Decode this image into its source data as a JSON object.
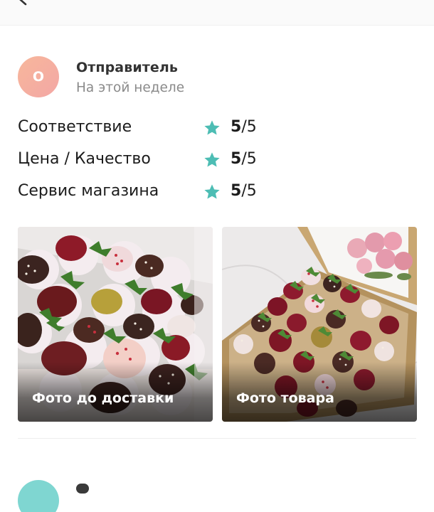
{
  "review": {
    "author": {
      "initial": "О",
      "name": "Отправитель",
      "date": "На этой неделе",
      "avatar_color": "#f5ae9e"
    },
    "ratings": [
      {
        "label": "Соответствие",
        "score": "5",
        "max": "/5"
      },
      {
        "label": "Цена / Качество",
        "score": "5",
        "max": "/5"
      },
      {
        "label": "Сервис магазина",
        "score": "5",
        "max": "/5"
      }
    ],
    "star_color": "#4dbdb4",
    "photos": [
      {
        "label": "Фото до доставки"
      },
      {
        "label": "Фото товара"
      }
    ]
  },
  "icons": {
    "back": "chevron-left-icon",
    "star": "star-icon"
  }
}
